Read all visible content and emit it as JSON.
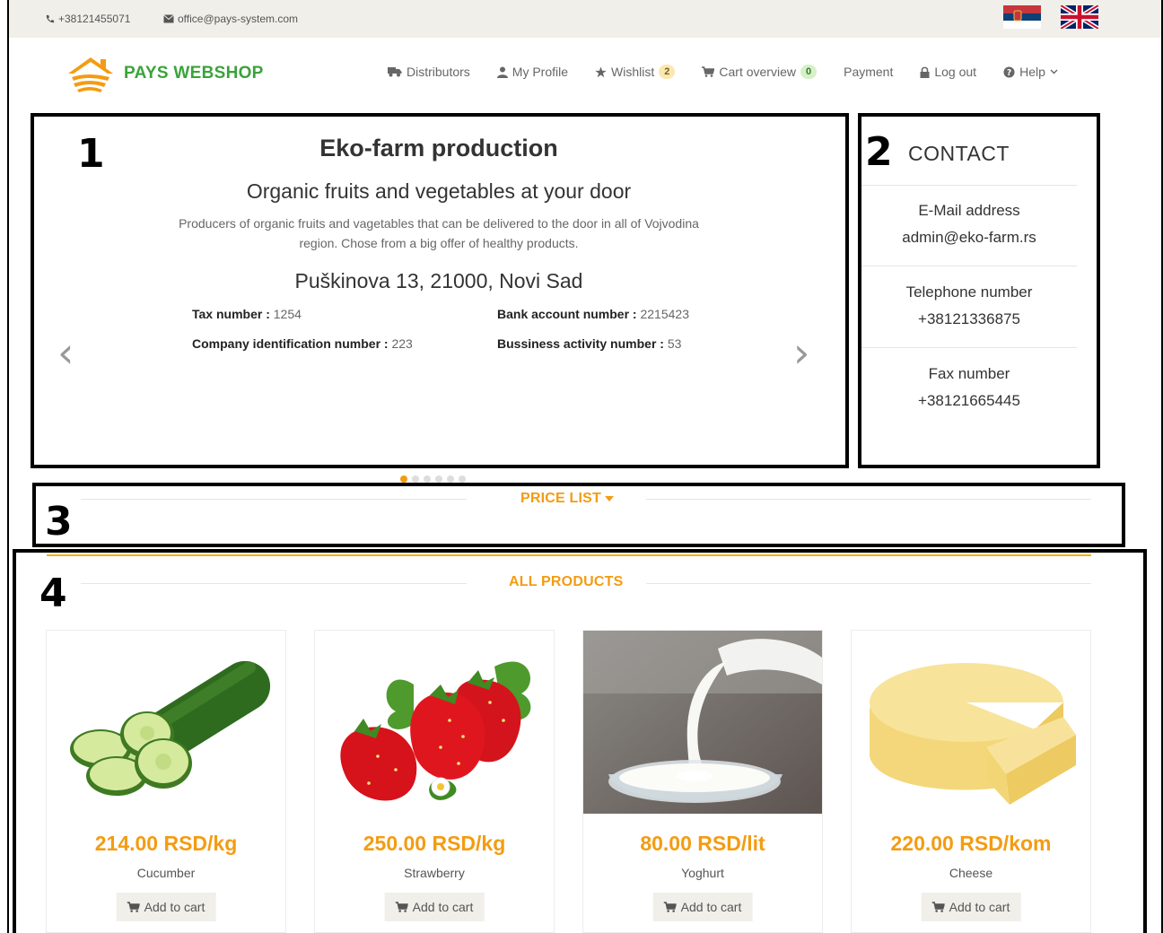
{
  "topbar": {
    "phone": "+38121455071",
    "email": "office@pays-system.com"
  },
  "brand": {
    "name": "PAYS WEBSHOP"
  },
  "nav": [
    {
      "label": "Distributors",
      "icon": "truck-icon"
    },
    {
      "label": "My Profile",
      "icon": "user-icon"
    },
    {
      "label": "Wishlist",
      "icon": "star-icon",
      "badge": "2"
    },
    {
      "label": "Cart overview",
      "icon": "cart-icon",
      "badge": "0"
    },
    {
      "label": "Payment"
    },
    {
      "label": "Log out",
      "icon": "lock-icon"
    },
    {
      "label": "Help",
      "icon": "question-icon"
    }
  ],
  "annotations": [
    "1",
    "2",
    "3",
    "4"
  ],
  "slide": {
    "title": "Eko-farm production",
    "subtitle": "Organic fruits and vegetables at your door",
    "description": "Producers of organic fruits and vagetables that can be delivered to the door in all of Vojvodina region. Chose from a big offer of healthy products.",
    "address": "Puškinova 13, 21000, Novi Sad",
    "tax_label": "Tax number :",
    "tax_value": "1254",
    "bank_label": "Bank account number :",
    "bank_value": "2215423",
    "company_label": "Company identification number :",
    "company_value": "223",
    "activity_label": "Bussiness activity number :",
    "activity_value": "53",
    "prev": "‹",
    "next": "›",
    "dot_count": 6,
    "active_dot": 0
  },
  "contact": {
    "title": "CONTACT",
    "email_label": "E-Mail address",
    "email": "admin@eko-farm.rs",
    "phone_label": "Telephone number",
    "phone": "+38121336875",
    "fax_label": "Fax number",
    "fax": "+38121665445"
  },
  "price_list": {
    "title": "PRICE LIST"
  },
  "products_section": {
    "title": "ALL PRODUCTS"
  },
  "products": [
    {
      "price": "214.00 RSD/kg",
      "name": "Cucumber",
      "button": "Add to cart"
    },
    {
      "price": "250.00 RSD/kg",
      "name": "Strawberry",
      "button": "Add to cart"
    },
    {
      "price": "80.00 RSD/lit",
      "name": "Yoghurt",
      "button": "Add to cart"
    },
    {
      "price": "220.00 RSD/kom",
      "name": "Cheese",
      "button": "Add to cart"
    }
  ],
  "colors": {
    "accent": "#f39c12",
    "brand_green": "#3aa33a",
    "topbar": "#f0efe9"
  }
}
